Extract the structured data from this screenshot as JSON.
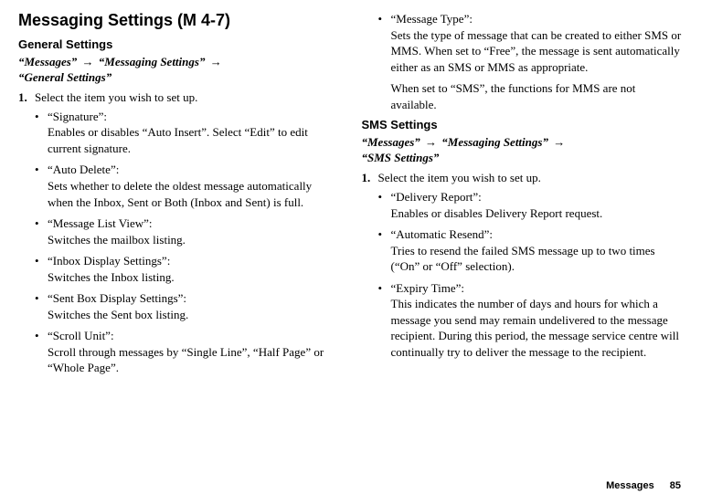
{
  "heading": "Messaging Settings (M 4-7)",
  "general": {
    "title": "General Settings",
    "nav": {
      "p1": "“Messages”",
      "p2": "“Messaging Settings”",
      "p3": "“General Settings”"
    },
    "step_num": "1.",
    "step_text": "Select the item you wish to set up.",
    "items": [
      {
        "title": "“Signature”:",
        "desc": "Enables or disables “Auto Insert”. Select “Edit” to edit current signature."
      },
      {
        "title": "“Auto Delete”:",
        "desc": "Sets whether to delete the oldest message automatically when the Inbox, Sent or Both (Inbox and Sent) is full."
      },
      {
        "title": "“Message List View”:",
        "desc": "Switches the mailbox listing."
      },
      {
        "title": "“Inbox Display Settings”:",
        "desc": "Switches the Inbox listing."
      },
      {
        "title": "“Sent Box Display Settings”:",
        "desc": "Switches the Sent box listing."
      },
      {
        "title": "“Scroll Unit”:",
        "desc": "Scroll through messages by “Single Line”, “Half Page” or “Whole Page”."
      }
    ]
  },
  "messageType": {
    "title": "“Message Type”:",
    "desc": "Sets the type of message that can be created to either SMS or MMS. When set to “Free”, the message is sent automatically either as an SMS or MMS as appropriate.",
    "desc2": "When set to “SMS”, the functions for MMS are not available."
  },
  "sms": {
    "title": "SMS Settings",
    "nav": {
      "p1": "“Messages”",
      "p2": "“Messaging Settings”",
      "p3": "“SMS Settings”"
    },
    "step_num": "1.",
    "step_text": "Select the item you wish to set up.",
    "items": [
      {
        "title": "“Delivery Report”:",
        "desc": "Enables or disables Delivery Report request."
      },
      {
        "title": "“Automatic Resend”:",
        "desc": "Tries to resend the failed SMS message up to two times (“On” or “Off” selection)."
      },
      {
        "title": "“Expiry Time”:",
        "desc": "This indicates the number of days and hours for which a message you send may remain undelivered to the message recipient. During this period, the message service centre will continually try to deliver the message to the recipient."
      }
    ]
  },
  "footer": {
    "label": "Messages",
    "page": "85"
  },
  "arrow": "→"
}
